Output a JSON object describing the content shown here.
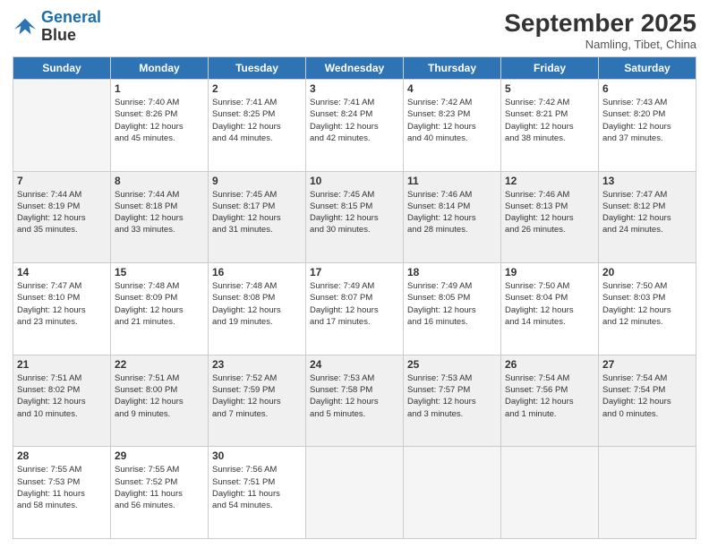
{
  "logo": {
    "line1": "General",
    "line2": "Blue"
  },
  "header": {
    "month": "September 2025",
    "location": "Namling, Tibet, China"
  },
  "days_of_week": [
    "Sunday",
    "Monday",
    "Tuesday",
    "Wednesday",
    "Thursday",
    "Friday",
    "Saturday"
  ],
  "weeks": [
    [
      {
        "day": "",
        "info": ""
      },
      {
        "day": "1",
        "info": "Sunrise: 7:40 AM\nSunset: 8:26 PM\nDaylight: 12 hours\nand 45 minutes."
      },
      {
        "day": "2",
        "info": "Sunrise: 7:41 AM\nSunset: 8:25 PM\nDaylight: 12 hours\nand 44 minutes."
      },
      {
        "day": "3",
        "info": "Sunrise: 7:41 AM\nSunset: 8:24 PM\nDaylight: 12 hours\nand 42 minutes."
      },
      {
        "day": "4",
        "info": "Sunrise: 7:42 AM\nSunset: 8:23 PM\nDaylight: 12 hours\nand 40 minutes."
      },
      {
        "day": "5",
        "info": "Sunrise: 7:42 AM\nSunset: 8:21 PM\nDaylight: 12 hours\nand 38 minutes."
      },
      {
        "day": "6",
        "info": "Sunrise: 7:43 AM\nSunset: 8:20 PM\nDaylight: 12 hours\nand 37 minutes."
      }
    ],
    [
      {
        "day": "7",
        "info": "Sunrise: 7:44 AM\nSunset: 8:19 PM\nDaylight: 12 hours\nand 35 minutes."
      },
      {
        "day": "8",
        "info": "Sunrise: 7:44 AM\nSunset: 8:18 PM\nDaylight: 12 hours\nand 33 minutes."
      },
      {
        "day": "9",
        "info": "Sunrise: 7:45 AM\nSunset: 8:17 PM\nDaylight: 12 hours\nand 31 minutes."
      },
      {
        "day": "10",
        "info": "Sunrise: 7:45 AM\nSunset: 8:15 PM\nDaylight: 12 hours\nand 30 minutes."
      },
      {
        "day": "11",
        "info": "Sunrise: 7:46 AM\nSunset: 8:14 PM\nDaylight: 12 hours\nand 28 minutes."
      },
      {
        "day": "12",
        "info": "Sunrise: 7:46 AM\nSunset: 8:13 PM\nDaylight: 12 hours\nand 26 minutes."
      },
      {
        "day": "13",
        "info": "Sunrise: 7:47 AM\nSunset: 8:12 PM\nDaylight: 12 hours\nand 24 minutes."
      }
    ],
    [
      {
        "day": "14",
        "info": "Sunrise: 7:47 AM\nSunset: 8:10 PM\nDaylight: 12 hours\nand 23 minutes."
      },
      {
        "day": "15",
        "info": "Sunrise: 7:48 AM\nSunset: 8:09 PM\nDaylight: 12 hours\nand 21 minutes."
      },
      {
        "day": "16",
        "info": "Sunrise: 7:48 AM\nSunset: 8:08 PM\nDaylight: 12 hours\nand 19 minutes."
      },
      {
        "day": "17",
        "info": "Sunrise: 7:49 AM\nSunset: 8:07 PM\nDaylight: 12 hours\nand 17 minutes."
      },
      {
        "day": "18",
        "info": "Sunrise: 7:49 AM\nSunset: 8:05 PM\nDaylight: 12 hours\nand 16 minutes."
      },
      {
        "day": "19",
        "info": "Sunrise: 7:50 AM\nSunset: 8:04 PM\nDaylight: 12 hours\nand 14 minutes."
      },
      {
        "day": "20",
        "info": "Sunrise: 7:50 AM\nSunset: 8:03 PM\nDaylight: 12 hours\nand 12 minutes."
      }
    ],
    [
      {
        "day": "21",
        "info": "Sunrise: 7:51 AM\nSunset: 8:02 PM\nDaylight: 12 hours\nand 10 minutes."
      },
      {
        "day": "22",
        "info": "Sunrise: 7:51 AM\nSunset: 8:00 PM\nDaylight: 12 hours\nand 9 minutes."
      },
      {
        "day": "23",
        "info": "Sunrise: 7:52 AM\nSunset: 7:59 PM\nDaylight: 12 hours\nand 7 minutes."
      },
      {
        "day": "24",
        "info": "Sunrise: 7:53 AM\nSunset: 7:58 PM\nDaylight: 12 hours\nand 5 minutes."
      },
      {
        "day": "25",
        "info": "Sunrise: 7:53 AM\nSunset: 7:57 PM\nDaylight: 12 hours\nand 3 minutes."
      },
      {
        "day": "26",
        "info": "Sunrise: 7:54 AM\nSunset: 7:56 PM\nDaylight: 12 hours\nand 1 minute."
      },
      {
        "day": "27",
        "info": "Sunrise: 7:54 AM\nSunset: 7:54 PM\nDaylight: 12 hours\nand 0 minutes."
      }
    ],
    [
      {
        "day": "28",
        "info": "Sunrise: 7:55 AM\nSunset: 7:53 PM\nDaylight: 11 hours\nand 58 minutes."
      },
      {
        "day": "29",
        "info": "Sunrise: 7:55 AM\nSunset: 7:52 PM\nDaylight: 11 hours\nand 56 minutes."
      },
      {
        "day": "30",
        "info": "Sunrise: 7:56 AM\nSunset: 7:51 PM\nDaylight: 11 hours\nand 54 minutes."
      },
      {
        "day": "",
        "info": ""
      },
      {
        "day": "",
        "info": ""
      },
      {
        "day": "",
        "info": ""
      },
      {
        "day": "",
        "info": ""
      }
    ]
  ]
}
